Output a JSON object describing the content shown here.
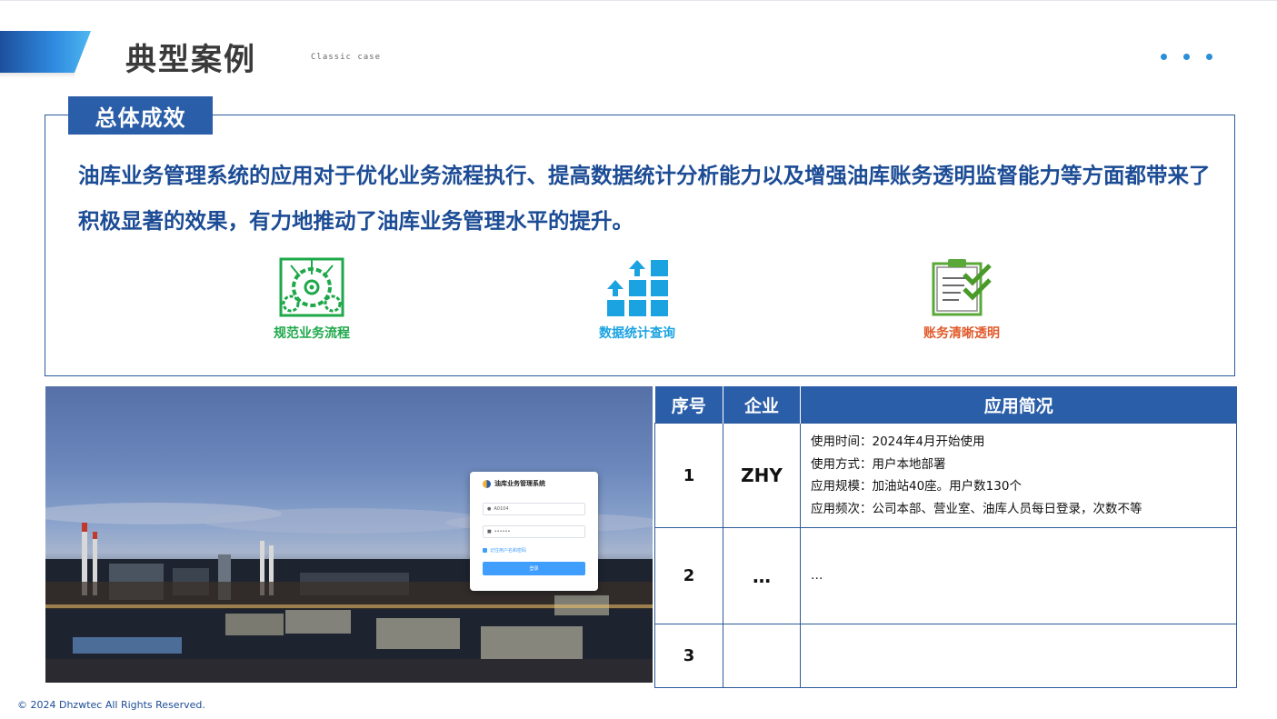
{
  "header": {
    "title": "典型案例",
    "subtitle": "Classic case"
  },
  "summary": {
    "tab_label": "总体成效",
    "text": "油库业务管理系统的应用对于优化业务流程执行、提高数据统计分析能力以及增强油库账务透明监督能力等方面都带来了积极显著的效果，有力地推动了油库业务管理水平的提升。",
    "features": [
      {
        "label": "规范业务流程",
        "icon": "gear-process-icon",
        "color": "#1ea84a"
      },
      {
        "label": "数据统计查询",
        "icon": "data-statistics-icon",
        "color": "#1aa3e0"
      },
      {
        "label": "账务清晰透明",
        "icon": "clipboard-check-icon",
        "color": "#e05a2b"
      }
    ]
  },
  "login_card": {
    "title": "油库业务管理系统",
    "username_value": "A0104",
    "password_value": "••••••",
    "remember_label": "记住用户名和密码",
    "login_button": "登录"
  },
  "table": {
    "headers": [
      "序号",
      "企业",
      "应用简况"
    ],
    "rows": [
      {
        "num": "1",
        "company": "ZHY",
        "details": [
          "使用时间：2024年4月开始使用",
          "使用方式：用户本地部署",
          "应用规模：加油站40座。用户数130个",
          "应用频次：公司本部、营业室、油库人员每日登录，次数不等"
        ]
      },
      {
        "num": "2",
        "company": "…",
        "details": [
          "…"
        ]
      },
      {
        "num": "3",
        "company": "",
        "details": []
      }
    ]
  },
  "footer": {
    "copyright": "© 2024  Dhzwtec All Rights Reserved."
  },
  "colors": {
    "brand_blue": "#2b5ea8",
    "text_blue": "#1c4c95",
    "green": "#1ea84a",
    "cyan": "#1aa3e0",
    "orange": "#e05a2b"
  }
}
